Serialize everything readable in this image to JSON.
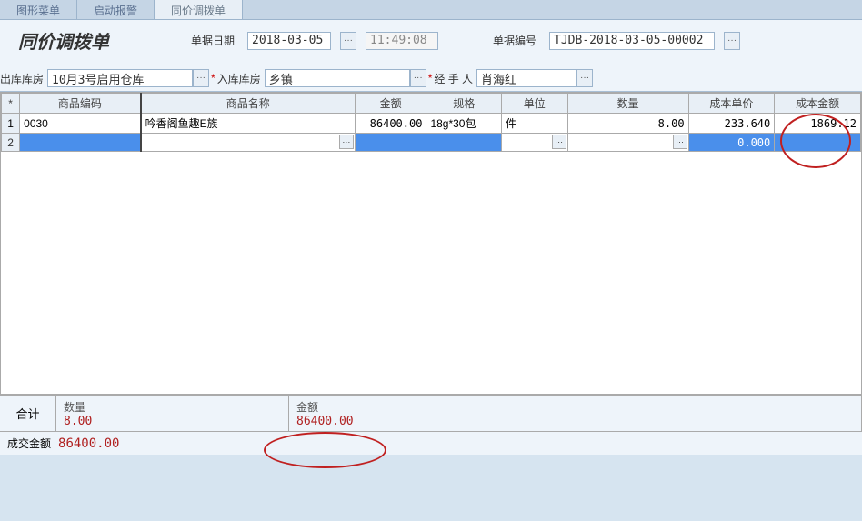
{
  "tabs": {
    "t0": "图形菜单",
    "t1": "启动报警",
    "t2": "同价调拨单"
  },
  "title": "同价调拨单",
  "header": {
    "date_label": "单据日期",
    "date_value": "2018-03-05",
    "time_value": "11:49:08",
    "no_label": "单据编号",
    "no_value": "TJDB-2018-03-05-00002"
  },
  "filters": {
    "out_label": "出库库房",
    "out_value": "10月3号启用仓库",
    "in_label": "入库库房",
    "in_value": "乡镇",
    "hand_label": "经 手 人",
    "hand_value": "肖海红"
  },
  "columns": {
    "code": "商品编码",
    "name": "商品名称",
    "amt": "金额",
    "spec": "规格",
    "unit": "单位",
    "qty": "数量",
    "cprice": "成本单价",
    "camt": "成本金额"
  },
  "rows": [
    {
      "code": "0030",
      "name": "吟香阁鱼趣E族",
      "amt": "86400.00",
      "spec": "18g*30包",
      "unit": "件",
      "qty": "8.00",
      "cprice": "233.640",
      "camt": "1869.12"
    }
  ],
  "blank_row": {
    "cprice": "0.000"
  },
  "totals": {
    "label": "合计",
    "qty_label": "数量",
    "qty_value": "8.00",
    "amt_label": "金额",
    "amt_value": "86400.00"
  },
  "deal": {
    "label": "成交金额",
    "value": "86400.00"
  },
  "ellipsis": "···"
}
